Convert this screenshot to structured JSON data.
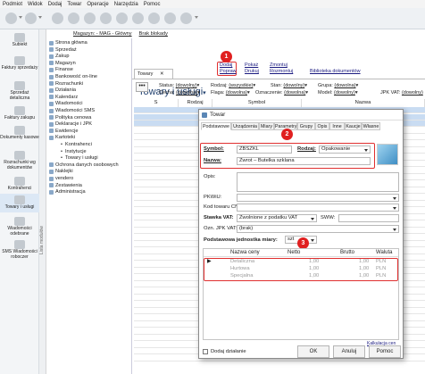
{
  "menu": [
    "Podmiot",
    "Widok",
    "Dodaj",
    "Towar",
    "Operacje",
    "Narzędzia",
    "Pomoc"
  ],
  "left_nav": {
    "top_label": "Subiekt",
    "items": [
      {
        "label": "Faktury sprzedaży"
      },
      {
        "label": "Sprzedaż detaliczna"
      },
      {
        "label": "Faktury zakupu"
      },
      {
        "label": "Dokumenty kasowe"
      },
      {
        "label": "Rozrachunki wg dokumentów"
      },
      {
        "label": "Kontrahenci"
      },
      {
        "label": "Towary i usługi"
      },
      {
        "label": "Wiadomości odebrane"
      },
      {
        "label": "SMS Wiadomości roboczer"
      }
    ],
    "modules_label": "Lista modułów"
  },
  "topfilter": {
    "magazyn": "Magazyn: - MAG - Główny",
    "blokady": "Brak blokady"
  },
  "tree": {
    "items": [
      "Strona główna",
      "Sprzedaż",
      "Zakup",
      "Magazyn",
      "Finanse",
      "Bankowość on-line",
      "Rozrachunki",
      "Działania",
      "Kalendarz",
      "Wiadomości",
      "Wiadomości SMS",
      "Polityka cenowa",
      "Deklaracje i JPK",
      "Ewidencje",
      "Kartoteki"
    ],
    "subitems": [
      "Kontrahenci",
      "Instytucje",
      "Towary i usługi"
    ],
    "items_after": [
      "Ochrona danych osobowych",
      "Naklejki",
      "vendero",
      "Zestawienia",
      "Administracja"
    ]
  },
  "doc_tab": {
    "label": "Towary"
  },
  "page": {
    "title": "Towary i usługi",
    "links_row1": [
      "Dodaj",
      "Pokaż",
      "Zmontuj"
    ],
    "links_row2": [
      "Popraw",
      "Drukuj",
      "Rozmontuj",
      "Biblioteka dokumentów"
    ],
    "filters": {
      "status_label": "Status:",
      "status_value": "(dowolny)",
      "rodzaj_label": "Rodzaj:",
      "rodzaj_value": "(wszystkie)",
      "stan_label": "Stan:",
      "stan_value": "(dowolny)",
      "grupa_label": "Grupa:",
      "grupa_value": "(dowolna)",
      "cecha_label": "Cecha:",
      "cecha_value": "(dowolna)",
      "flaga_label": "Flaga:",
      "flaga_value": "(dowolna)",
      "oznaczenie_label": "Oznaczenie:",
      "oznaczenie_value": "(dowolna)",
      "model_label": "Model:",
      "model_value": "(dowolny)",
      "jpk_label": "JPK VAT:",
      "jpk_value": "(dowolny)"
    },
    "columns": [
      "S",
      "Rodzaj",
      "Symbol",
      "Nazwa"
    ]
  },
  "badges": [
    "1",
    "2",
    "3"
  ],
  "dialog": {
    "title": "Towar",
    "tabs": [
      "Podstawowe",
      "Urządzenia",
      "Miary",
      "Parametry",
      "Grupy",
      "Opis",
      "Inne",
      "Kaucje",
      "Własne"
    ],
    "symbol_label": "Symbol:",
    "symbol_value": "ZBSZKL",
    "rodzaj_label": "Rodzaj:",
    "rodzaj_value": "Opakowanie",
    "nazwa_label": "Nazwa:",
    "nazwa_value": "Zwrot – Butelka szklana",
    "opis_label": "Opis:",
    "pkwiu_label": "PKWiU:",
    "kod_label": "Kod towaru CN:",
    "stawka_label": "Stawka VAT:",
    "stawka_value": "Zwolnione z podatku VAT",
    "sww_label": "SWW:",
    "jpk_label": "Ozn. JPK VAT:",
    "jpk_value": "(brak)",
    "jm_label": "Podstawowa jednostka miary:",
    "jm_value": "szt",
    "price_cols": [
      "Nazwa ceny",
      "Netto",
      "Brutto",
      "Waluta"
    ],
    "prices": [
      {
        "name": "Detaliczna",
        "netto": "1,00",
        "brutto": "1,00",
        "waluta": "PLN"
      },
      {
        "name": "Hurtowa",
        "netto": "1,00",
        "brutto": "1,00",
        "waluta": "PLN"
      },
      {
        "name": "Specjalna",
        "netto": "1,00",
        "brutto": "1,00",
        "waluta": "PLN"
      }
    ],
    "kalkulacja": "Kalkulacja cen",
    "dodaj_dzialanie": "Dodaj działanie",
    "ok": "OK",
    "anuluj": "Anuluj",
    "pomoc": "Pomoc"
  },
  "colors": {
    "accent_red": "#e02020",
    "title_blue": "#1f3f6e",
    "row_blue": "#c9dcf2"
  }
}
